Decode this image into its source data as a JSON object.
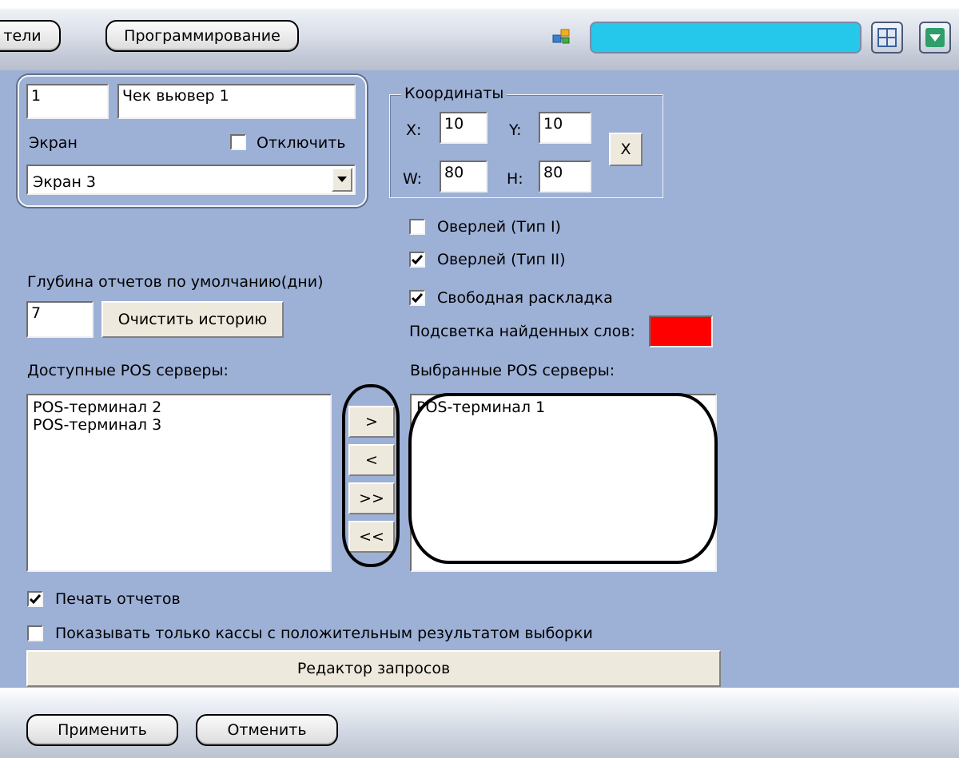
{
  "toolbar": {
    "tab_partial_label": "тели",
    "tab_programming_label": "Программирование",
    "status_color": "#25c8ea"
  },
  "object": {
    "id_value": "1",
    "name_value": "Чек вьювер 1",
    "screen_label": "Экран",
    "disable_label": "Отключить",
    "disable_checked": false,
    "screen_select_value": "Экран 3"
  },
  "coordinates": {
    "group_label": "Координаты",
    "x_label": "X:",
    "x_value": "10",
    "y_label": "Y:",
    "y_value": "10",
    "w_label": "W:",
    "w_value": "80",
    "h_label": "H:",
    "h_value": "80",
    "reset_label": "X"
  },
  "options": {
    "overlay1_label": "Оверлей (Тип I)",
    "overlay1_checked": false,
    "overlay2_label": "Оверлей (Тип II)",
    "overlay2_checked": true,
    "free_layout_label": "Свободная раскладка",
    "free_layout_checked": true,
    "highlight_label": "Подсветка найденных слов:",
    "highlight_color": "#ff0000"
  },
  "history": {
    "depth_label": "Глубина отчетов по умолчанию(дни)",
    "depth_value": "7",
    "clear_button_label": "Очистить историю"
  },
  "pos": {
    "available_label": "Доступные POS серверы:",
    "available_items": [
      "POS-терминал 2",
      "POS-терминал 3"
    ],
    "selected_label": "Выбранные POS серверы:",
    "selected_items": [
      "POS-терминал 1"
    ],
    "move_right_label": ">",
    "move_left_label": "<",
    "move_all_right_label": ">>",
    "move_all_left_label": "<<"
  },
  "print": {
    "print_reports_label": "Печать отчетов",
    "print_reports_checked": true,
    "positive_only_label": "Показывать только кассы с положительным результатом выборки",
    "positive_only_checked": false
  },
  "query_editor_label": "Редактор запросов",
  "footer": {
    "apply_label": "Применить",
    "cancel_label": "Отменить"
  }
}
